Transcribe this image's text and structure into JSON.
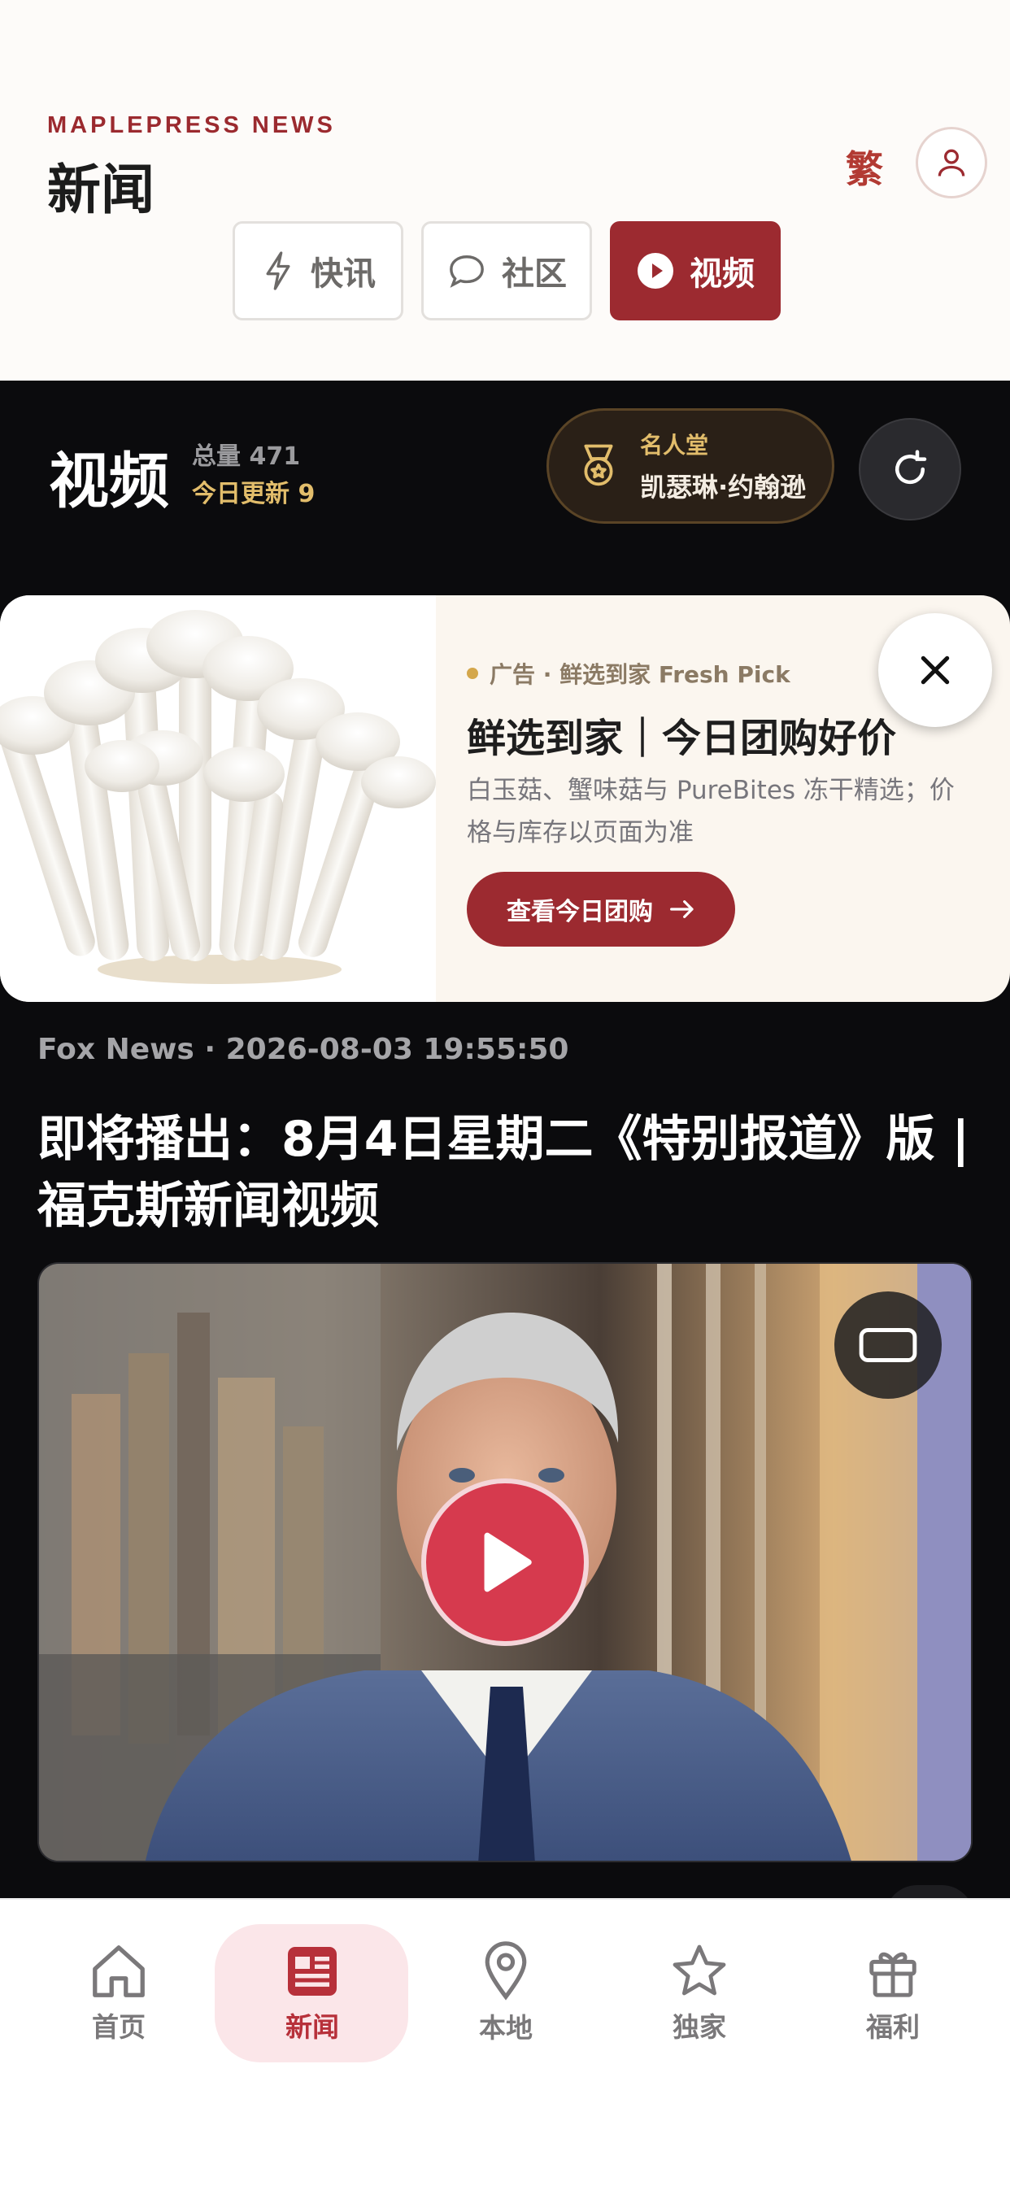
{
  "header": {
    "brand": "MAPLEPRESS NEWS",
    "title": "新闻",
    "traditional_toggle": "繁",
    "tabs": [
      {
        "label": "快讯",
        "icon": "lightning-icon"
      },
      {
        "label": "社区",
        "icon": "chat-bubble-icon"
      },
      {
        "label": "视频",
        "icon": "play-circle-icon",
        "active": true
      }
    ]
  },
  "section": {
    "title": "视频",
    "total": "总量 471",
    "today": "今日更新 9",
    "hall_of_fame": {
      "label": "名人堂",
      "name": "凯瑟琳·约翰逊",
      "icon": "medal-icon"
    },
    "refresh_icon": "refresh-icon"
  },
  "ad": {
    "tag": "广告 · 鲜选到家 Fresh Pick",
    "headline": "鲜选到家｜今日团购好价",
    "description": "白玉菇、蟹味菇与 PureBites 冻干精选；价格与库存以页面为准",
    "cta": "查看今日团购",
    "cta_icon": "arrow-right-icon",
    "close_icon": "close-icon"
  },
  "article": {
    "meta": "Fox News · 2026-08-03 19:55:50",
    "headline": "即将播出：8月4日星期二《特别报道》版 | 福克斯新闻视频",
    "cast_icon": "cast-screen-icon",
    "play_icon": "play-icon"
  },
  "bottom_nav": [
    {
      "label": "首页",
      "icon": "home-icon"
    },
    {
      "label": "新闻",
      "icon": "newspaper-icon",
      "active": true
    },
    {
      "label": "本地",
      "icon": "location-pin-icon"
    },
    {
      "label": "独家",
      "icon": "star-icon"
    },
    {
      "label": "福利",
      "icon": "gift-icon"
    }
  ],
  "colors": {
    "brand": "#9c2a30",
    "gold": "#e2bd6b",
    "dark_bg": "#0b0b0d",
    "play": "#d63a4e"
  }
}
